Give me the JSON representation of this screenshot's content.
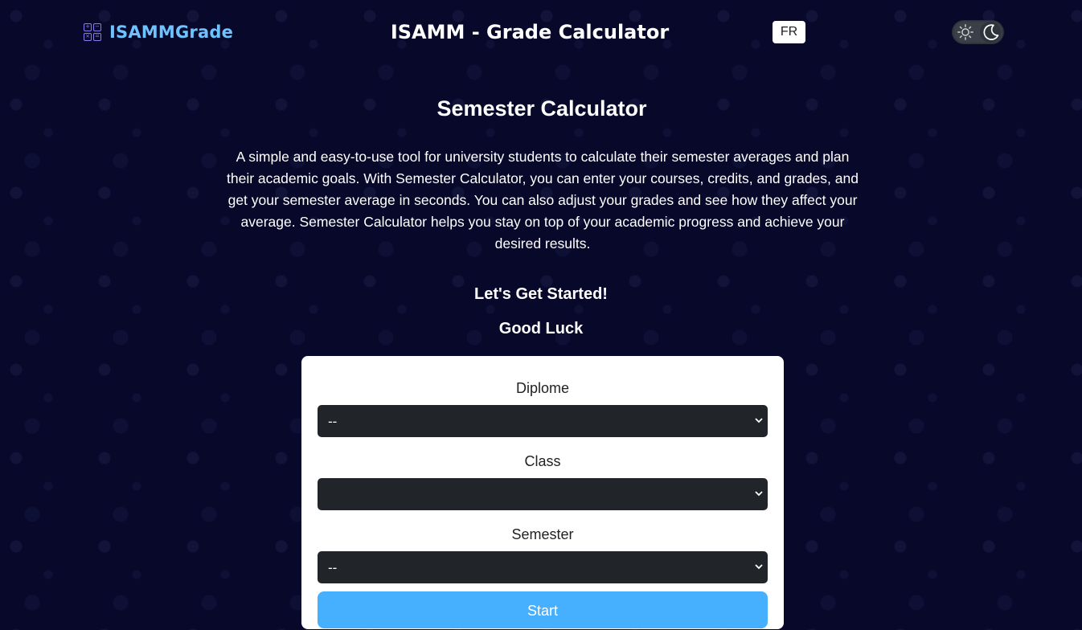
{
  "header": {
    "logo_text": "ISAMMGrade",
    "logo_icon": "calculator-icon",
    "site_title": "ISAMM - Grade Calculator",
    "lang_button": "FR",
    "theme_toggle": {
      "sun_icon": "sun-icon",
      "moon_icon": "moon-icon",
      "mode": "dark"
    }
  },
  "main": {
    "title": "Semester Calculator",
    "description": "A simple and easy-to-use tool for university students to calculate their semester averages and plan their academic goals. With Semester Calculator, you can enter your courses, credits, and grades, and get your semester average in seconds. You can also adjust your grades and see how they affect your average. Semester Calculator helps you stay on top of your academic progress and achieve your desired results.",
    "cta_line1": "Let's Get Started!",
    "cta_line2": "Good Luck"
  },
  "form": {
    "diplome": {
      "label": "Diplome",
      "value": "--"
    },
    "class": {
      "label": "Class",
      "value": ""
    },
    "semester": {
      "label": "Semester",
      "value": "--"
    },
    "start_label": "Start"
  },
  "colors": {
    "background": "#07082a",
    "logo_text": "#6ec3ff",
    "logo_icon": "#8b7bf0",
    "select_bg": "#212529",
    "start_button": "#46b0ff"
  }
}
